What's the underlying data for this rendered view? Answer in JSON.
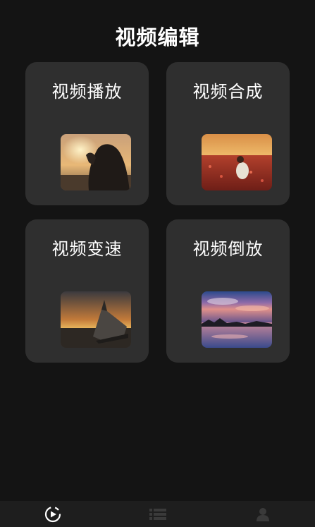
{
  "page": {
    "title": "视频编辑"
  },
  "cards": [
    {
      "label": "视频播放"
    },
    {
      "label": "视频合成"
    },
    {
      "label": "视频变速"
    },
    {
      "label": "视频倒放"
    }
  ],
  "tabs": [
    {
      "icon": "play-circle-icon",
      "active": true,
      "color": "#ffffff"
    },
    {
      "icon": "list-icon",
      "active": false,
      "color": "#3a3a3a"
    },
    {
      "icon": "user-icon",
      "active": false,
      "color": "#3a3a3a"
    }
  ]
}
